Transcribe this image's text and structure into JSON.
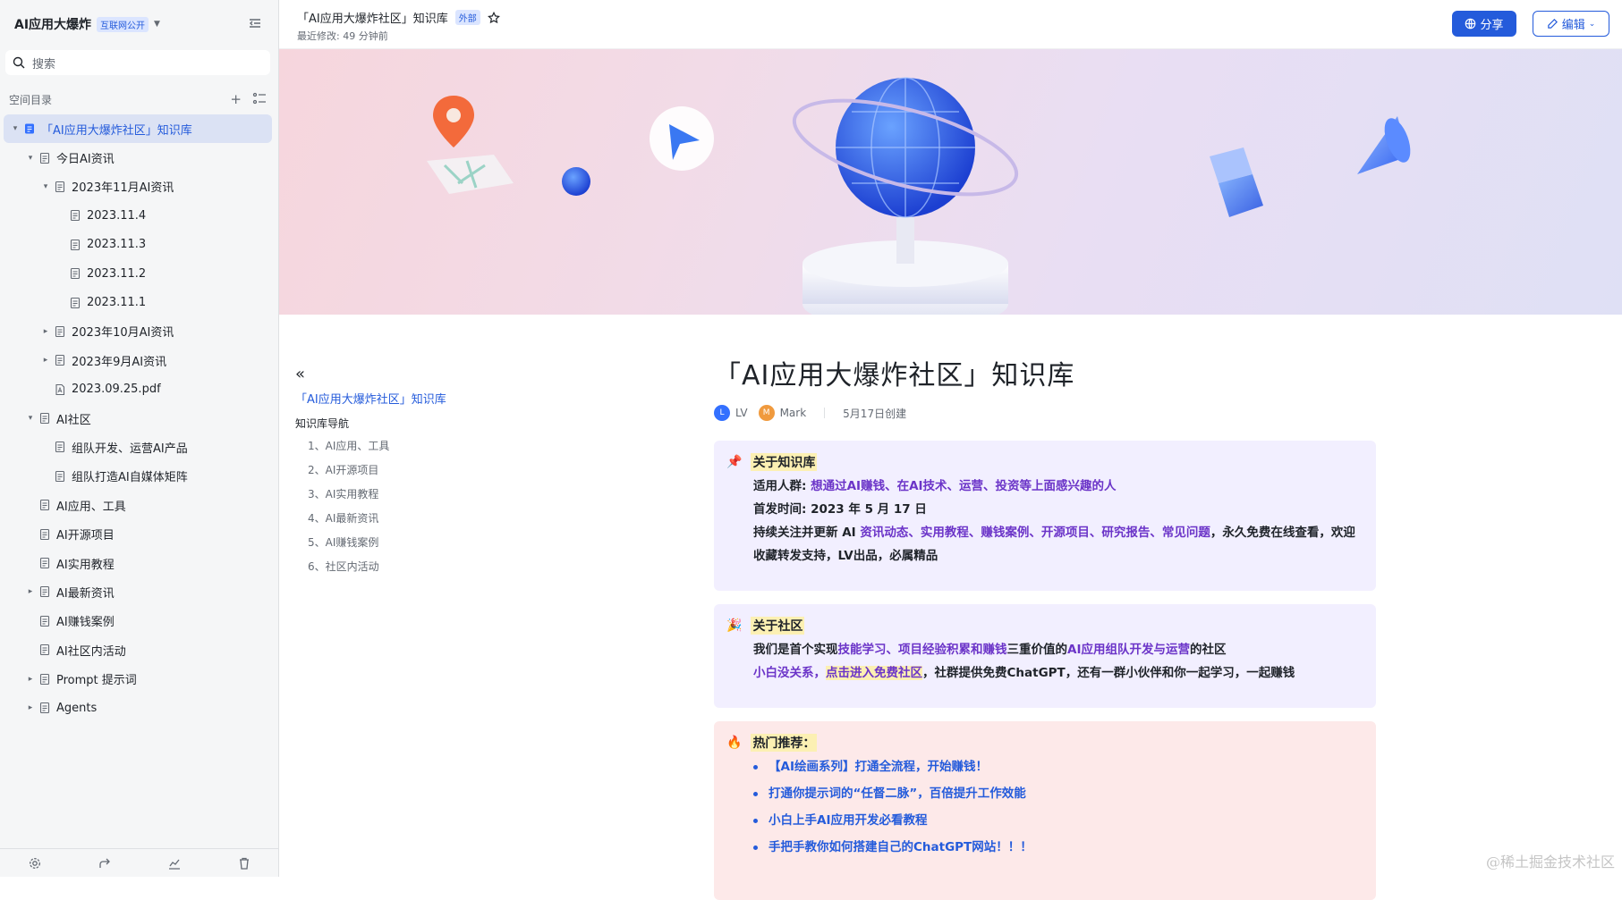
{
  "sidebar": {
    "space_title": "AI应用大爆炸",
    "visibility_badge": "互联网公开",
    "search_placeholder": "搜索",
    "section_label": "空间目录",
    "tree": [
      {
        "label": "「AI应用大爆炸社区」知识库",
        "depth": 0,
        "arrow": "down",
        "active": true
      },
      {
        "label": "今日AI资讯",
        "depth": 1,
        "arrow": "down"
      },
      {
        "label": "2023年11月AI资讯",
        "depth": 2,
        "arrow": "down"
      },
      {
        "label": "2023.11.4",
        "depth": 3,
        "arrow": ""
      },
      {
        "label": "2023.11.3",
        "depth": 3,
        "arrow": ""
      },
      {
        "label": "2023.11.2",
        "depth": 3,
        "arrow": ""
      },
      {
        "label": "2023.11.1",
        "depth": 3,
        "arrow": ""
      },
      {
        "label": "2023年10月AI资讯",
        "depth": 2,
        "arrow": "right"
      },
      {
        "label": "2023年9月AI资讯",
        "depth": 2,
        "arrow": "right"
      },
      {
        "label": "2023.09.25.pdf",
        "depth": 2,
        "arrow": "",
        "pdf": true
      },
      {
        "label": "AI社区",
        "depth": 1,
        "arrow": "down"
      },
      {
        "label": "组队开发、运营AI产品",
        "depth": 2,
        "arrow": ""
      },
      {
        "label": "组队打造AI自媒体矩阵",
        "depth": 2,
        "arrow": ""
      },
      {
        "label": "AI应用、工具",
        "depth": 1,
        "arrow": ""
      },
      {
        "label": "AI开源项目",
        "depth": 1,
        "arrow": ""
      },
      {
        "label": "AI实用教程",
        "depth": 1,
        "arrow": ""
      },
      {
        "label": "AI最新资讯",
        "depth": 1,
        "arrow": "right"
      },
      {
        "label": "AI赚钱案例",
        "depth": 1,
        "arrow": ""
      },
      {
        "label": "AI社区内活动",
        "depth": 1,
        "arrow": ""
      },
      {
        "label": "Prompt 提示词",
        "depth": 1,
        "arrow": "right"
      },
      {
        "label": "Agents",
        "depth": 1,
        "arrow": "right"
      }
    ]
  },
  "topbar": {
    "doc_title": "「AI应用大爆炸社区」知识库",
    "external_badge": "外部",
    "last_modified": "最近修改: 49 分钟前",
    "share_label": "分享",
    "edit_label": "编辑"
  },
  "toc": {
    "root": "「AI应用大爆炸社区」知识库",
    "nav_heading": "知识库导航",
    "items": [
      "1、AI应用、工具",
      "2、AI开源项目",
      "3、AI实用教程",
      "4、AI最新资讯",
      "5、AI赚钱案例",
      "6、社区内活动"
    ]
  },
  "doc": {
    "title": "「AI应用大爆炸社区」知识库",
    "author1_initial": "L",
    "author1": "LV",
    "author2_initial": "M",
    "author2": "Mark",
    "created": "5月17日创建",
    "card1": {
      "emoji": "📌",
      "title": "关于知识库",
      "audience_label": "适用人群: ",
      "audience_value": "想通过AI赚钱、在AI技术、运营、投资等上面感兴趣的人",
      "first_pub": "首发时间: 2023 年 5 月 17 日",
      "update_prefix": "持续关注并更新 AI ",
      "update_links": "资讯动态、实用教程、赚钱案例、开源项目、研究报告、常见问题",
      "update_suffix": "，永久免费在线查看，欢迎收藏转发支持，LV出品，必属精品"
    },
    "card2": {
      "emoji": "🎉",
      "title": "关于社区",
      "l1_a": "我们是首个实现",
      "l1_b": "技能学习、项目经验积累和赚钱",
      "l1_c": "三重价值的",
      "l1_d": "AI应用组队开发与运营",
      "l1_e": "的社区",
      "l2_a": "小白没关系，",
      "l2_b": "点击进入免费社区",
      "l2_c": "，社群提供免费ChatGPT，还有一群小伙伴和你一起学习，一起赚钱"
    },
    "card3": {
      "emoji": "🔥",
      "title": "热门推荐：",
      "items": [
        "【AI绘画系列】打通全流程，开始赚钱！",
        "打通你提示词的“任督二脉”，百倍提升工作效能",
        "小白上手AI应用开发必看教程",
        "手把手教你如何搭建自己的ChatGPT网站！！！"
      ]
    }
  },
  "watermark": "@稀土掘金技术社区",
  "colors": {
    "accent": "#245bdb",
    "purple": "#6b34c8",
    "card_purple": "#f2efff",
    "card_red": "#fde9e9"
  }
}
